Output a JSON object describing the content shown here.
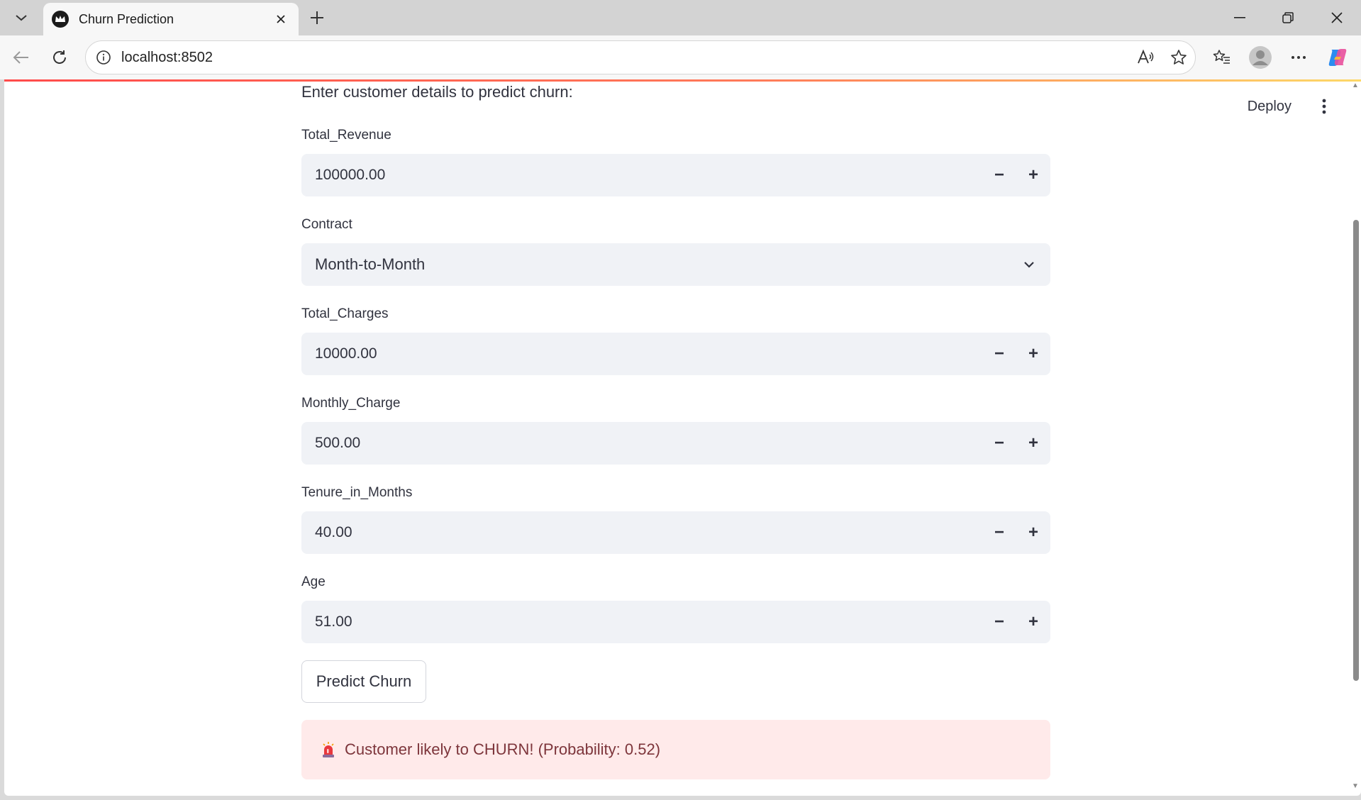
{
  "browser": {
    "tab_title": "Churn Prediction",
    "url": "localhost:8502"
  },
  "app": {
    "deploy_label": "Deploy",
    "intro": "Enter customer details to predict churn:",
    "fields": {
      "total_revenue": {
        "label": "Total_Revenue",
        "value": "100000.00"
      },
      "contract": {
        "label": "Contract",
        "value": "Month-to-Month"
      },
      "total_charges": {
        "label": "Total_Charges",
        "value": "10000.00"
      },
      "monthly_charge": {
        "label": "Monthly_Charge",
        "value": "500.00"
      },
      "tenure_in_months": {
        "label": "Tenure_in_Months",
        "value": "40.00"
      },
      "age": {
        "label": "Age",
        "value": "51.00"
      }
    },
    "stepper": {
      "minus": "−",
      "plus": "+"
    },
    "predict_button": "Predict Churn",
    "result": {
      "icon": "siren-icon",
      "text": "Customer likely to CHURN! (Probability: 0.52)"
    }
  },
  "colors": {
    "accent": "#ff4b4b",
    "input_bg": "#f0f2f6",
    "error_bg": "#ffeaea",
    "error_text": "#7d353b",
    "text": "#31333f"
  }
}
